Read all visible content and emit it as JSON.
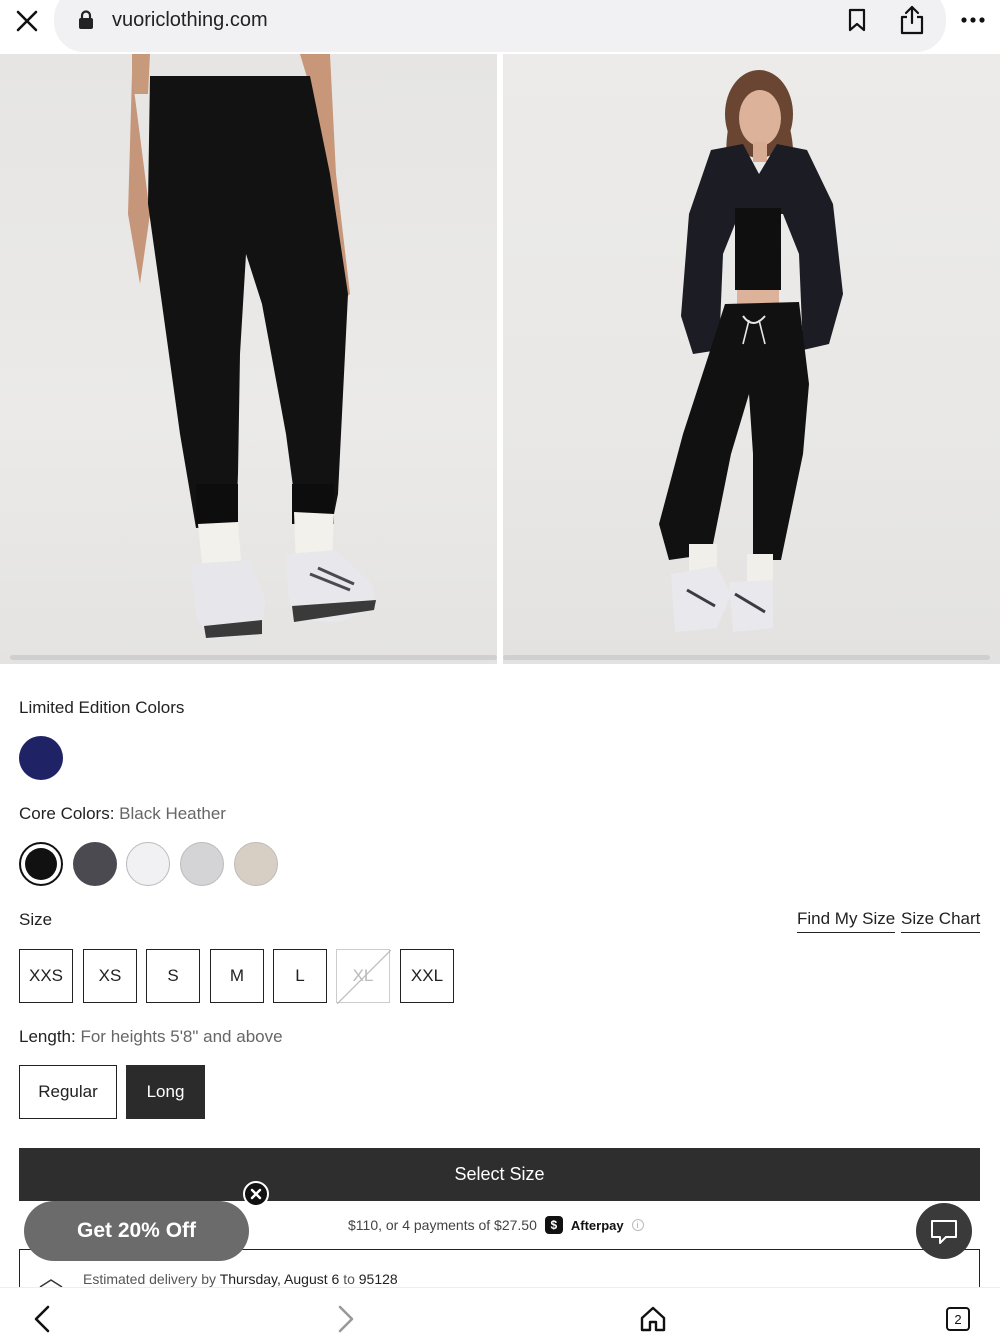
{
  "browser": {
    "url": "vuoriclothing.com",
    "tab_count": "2"
  },
  "product": {
    "limited_colors_label": "Limited Edition Colors",
    "core_colors_label": "Core Colors:",
    "core_colors_selected": "Black Heather",
    "size_label": "Size",
    "find_my_size": "Find My Size",
    "size_chart": "Size Chart",
    "sizes": [
      "XXS",
      "XS",
      "S",
      "M",
      "L",
      "XL",
      "XXL"
    ],
    "length_label": "Length:",
    "length_desc": "For heights 5'8\" and above",
    "length_options": [
      "Regular",
      "Long"
    ],
    "cta_label": "Select Size",
    "afterpay_text": "$110, or 4 payments of $27.50",
    "afterpay_brand": "Afterpay",
    "delivery_prefix": "Estimated delivery by",
    "delivery_date": "Thursday, August 6",
    "delivery_mid": "to",
    "delivery_zip": "95128"
  },
  "promo": {
    "label": "Get 20% Off"
  },
  "colors": {
    "limited": [
      "#1f2366"
    ],
    "core": [
      "#111111",
      "#4a4a50",
      "#f1f1f3",
      "#d4d4d6",
      "#d8cfc4"
    ],
    "cta_bg": "#2e2e2e"
  }
}
